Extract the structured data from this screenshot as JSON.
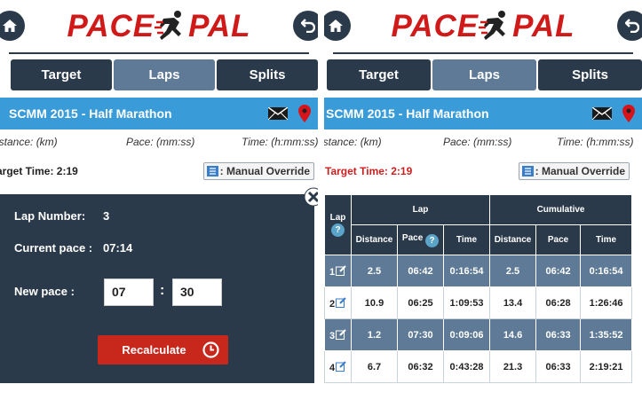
{
  "app": {
    "logo_left": "PACE",
    "logo_right": "PAL"
  },
  "tabs": [
    {
      "label": "Target"
    },
    {
      "label": "Laps"
    },
    {
      "label": "Splits"
    }
  ],
  "race": {
    "title": "SCMM 2015 - Half Marathon",
    "title_truncated": "SCMM 2015 - Half Marathon"
  },
  "units": {
    "distance": "Distance: (km)",
    "distance_left": "istance: (km)",
    "pace": "Pace: (mm:ss)",
    "time": "Time: (h:mm:ss)"
  },
  "target": {
    "label_left": "arget Time: 2:19",
    "label_right": "Target Time: 2:19",
    "override_label": ": Manual Override"
  },
  "popup": {
    "lap_number_label": "Lap Number:",
    "lap_number_value": "3",
    "current_pace_label": "Current pace :",
    "current_pace_value": "07:14",
    "new_pace_label": "New pace :",
    "new_pace_minutes": "07",
    "new_pace_seconds": "30",
    "recalculate_label": "Recalculate"
  },
  "table": {
    "headers": {
      "lap": "Lap",
      "lap_group": "Lap",
      "cumulative_group": "Cumulative",
      "distance": "Distance",
      "pace": "Pace",
      "time": "Time",
      "cum_distance": "Distance",
      "cum_pace": "Pace",
      "cum_time": "Time",
      "help": "?"
    },
    "rows": [
      {
        "lap": "1",
        "distance": "2.5",
        "pace": "06:42",
        "time": "0:16:54",
        "cum_distance": "2.5",
        "cum_pace": "06:42",
        "cum_time": "0:16:54"
      },
      {
        "lap": "2",
        "distance": "10.9",
        "pace": "06:25",
        "time": "1:09:53",
        "cum_distance": "13.4",
        "cum_pace": "06:28",
        "cum_time": "1:26:46"
      },
      {
        "lap": "3",
        "distance": "1.2",
        "pace": "07:30",
        "time": "0:09:06",
        "cum_distance": "14.6",
        "cum_pace": "06:33",
        "cum_time": "1:35:52"
      },
      {
        "lap": "4",
        "distance": "6.7",
        "pace": "06:32",
        "time": "0:43:28",
        "cum_distance": "21.3",
        "cum_pace": "06:33",
        "cum_time": "2:19:21"
      }
    ]
  },
  "colors": {
    "brand_red": "#d01a1a",
    "navy": "#2b3a4a",
    "tab_active": "#5e7a96",
    "race_bar": "#3a9bd9",
    "recalc_red": "#c8281c",
    "alert_red": "#cc1f1f"
  },
  "icons": {
    "home": "home-icon",
    "back": "back-arrow-icon",
    "mail": "mail-icon",
    "pin": "map-pin-icon",
    "override": "list-icon",
    "close": "close-icon",
    "clock": "clock-icon",
    "edit": "edit-icon",
    "help": "help-icon"
  }
}
